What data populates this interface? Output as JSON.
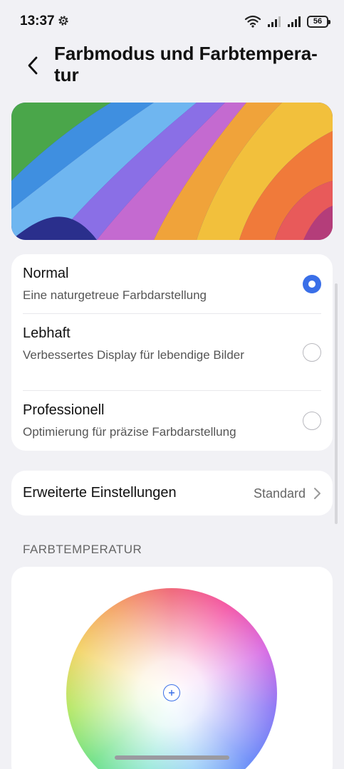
{
  "status_bar": {
    "time": "13:37",
    "battery": "56",
    "icons": [
      "gear-icon",
      "wifi-icon",
      "signal-icon",
      "signal-icon",
      "battery-icon"
    ]
  },
  "header": {
    "title": "Farbmodus und Farbtempera-tur",
    "back_icon": "back-arrow-icon"
  },
  "modes": [
    {
      "title": "Normal",
      "description": "Eine naturgetreue Farbdarstellung",
      "selected": true
    },
    {
      "title": "Lebhaft",
      "description": "Verbessertes Display für lebendige Bilder",
      "selected": false
    },
    {
      "title": "Professionell",
      "description": "Optimierung für präzise Farbdarstellung",
      "selected": false
    }
  ],
  "advanced": {
    "label": "Erweiterte Einstellungen",
    "value": "Standard"
  },
  "temperature": {
    "section_label": "FARBTEMPERATUR"
  },
  "colors": {
    "accent": "#3a6fe8",
    "background": "#f1f1f5",
    "card": "#ffffff"
  }
}
